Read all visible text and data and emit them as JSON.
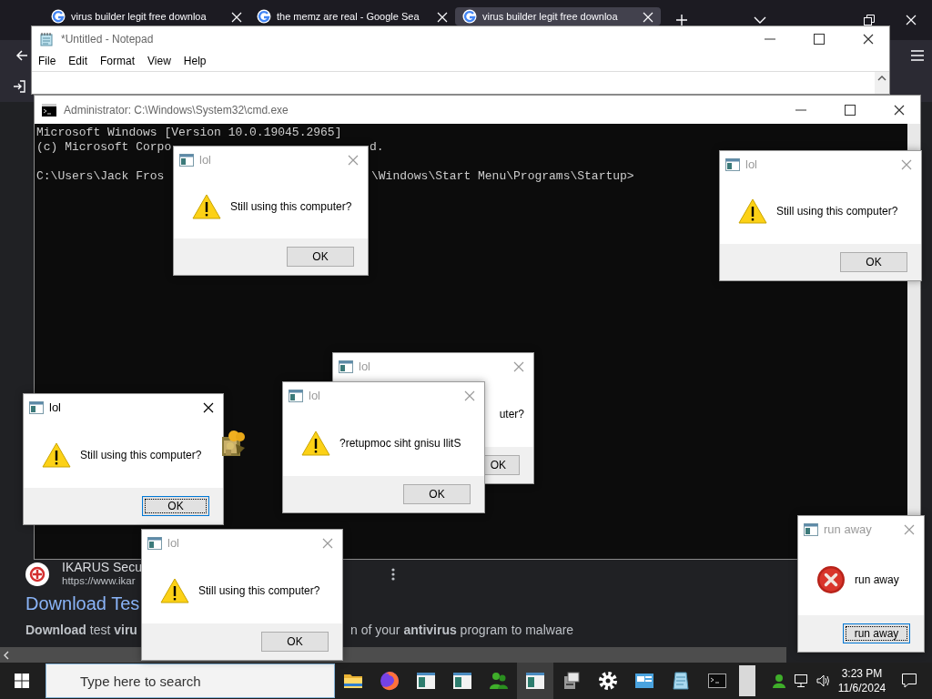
{
  "browser": {
    "tabs": [
      {
        "title": "virus builder legit free downloa",
        "selected": false
      },
      {
        "title": "the memz are real - Google Sea",
        "selected": false
      },
      {
        "title": "virus builder legit free downloa",
        "selected": true
      }
    ],
    "result": {
      "site": "IKARUS Secu",
      "url": "https://www.ikar",
      "title": "Download Tes",
      "snippet": [
        "**Download** test **viru**",
        "n of your **antivirus** program to malware"
      ]
    }
  },
  "notepad": {
    "title": "*Untitled - Notepad",
    "menu": [
      "File",
      "Edit",
      "Format",
      "View",
      "Help"
    ]
  },
  "cmd": {
    "title": "Administrator: C:\\Windows\\System32\\cmd.exe",
    "segments": [
      "Microsoft Windows [Version 10.0.19045.2965]",
      "(c) Microsoft Corpo",
      "d.",
      "C:\\Users\\Jack Fros",
      "\\Windows\\Start Menu\\Programs\\Startup>"
    ]
  },
  "dialogs": [
    {
      "title": "lol",
      "active": false,
      "kind": "warning",
      "message": "Still using this computer?",
      "button": "OK",
      "focused": false
    },
    {
      "title": "lol",
      "active": false,
      "kind": "warning",
      "message": "Still using this computer?",
      "button": "OK",
      "focused": false
    },
    {
      "title": "lol",
      "active": false,
      "kind": "covered",
      "message": "uter?",
      "button": "OK",
      "focused": false
    },
    {
      "title": "lol",
      "active": false,
      "kind": "warning",
      "message": "?retupmoc siht gnisu llitS",
      "button": "OK",
      "focused": false
    },
    {
      "title": "lol",
      "active": true,
      "kind": "warning",
      "message": "Still using this computer?",
      "button": "OK",
      "focused": true
    },
    {
      "title": "lol",
      "active": false,
      "kind": "warning",
      "message": "Still using this computer?",
      "button": "OK",
      "focused": false
    },
    {
      "title": "run away",
      "active": false,
      "kind": "error",
      "message": "run away",
      "button": "run away",
      "focused": true
    }
  ],
  "taskbar": {
    "search_placeholder": "Type here to search",
    "apps": [
      {
        "kind": "folder",
        "selected": false
      },
      {
        "kind": "browser",
        "selected": false
      },
      {
        "kind": "window",
        "selected": false
      },
      {
        "kind": "window",
        "selected": false
      },
      {
        "kind": "people",
        "selected": false
      },
      {
        "kind": "window",
        "selected": true
      },
      {
        "kind": "computer",
        "selected": false
      },
      {
        "kind": "settings",
        "selected": false
      },
      {
        "kind": "panel",
        "selected": false
      },
      {
        "kind": "notepad",
        "selected": false
      },
      {
        "kind": "terminal",
        "selected": false
      }
    ],
    "time": "3:23 PM",
    "date": "11/6/2024"
  }
}
